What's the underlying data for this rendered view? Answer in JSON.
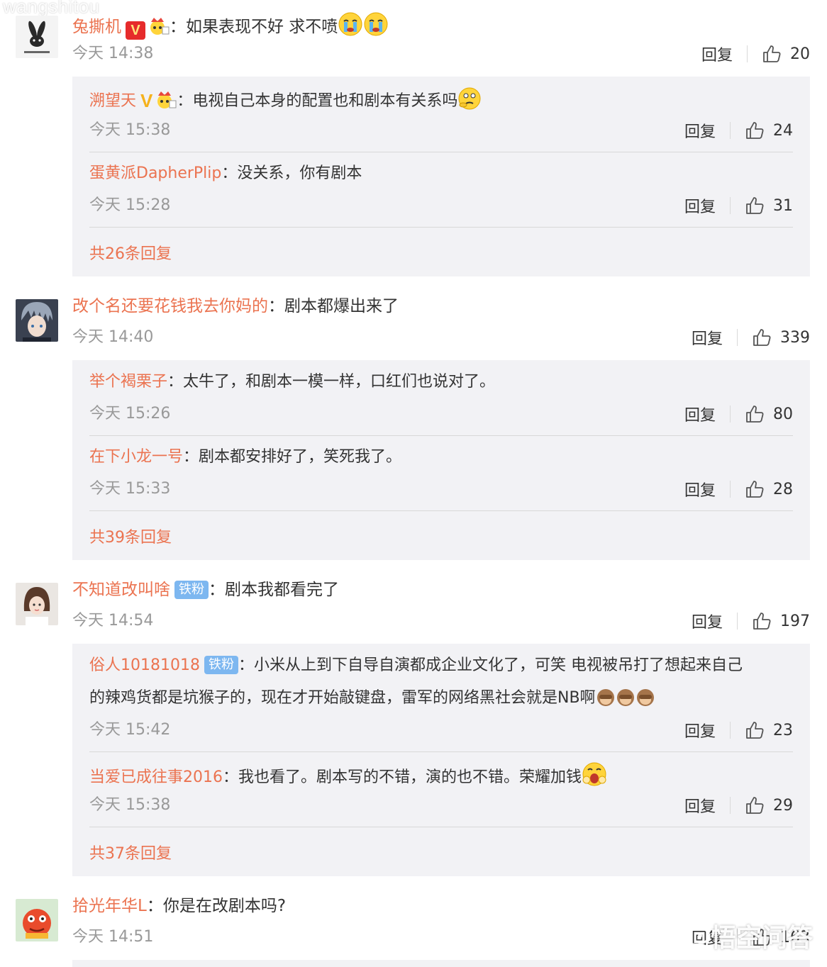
{
  "watermark_top": "wangshitou",
  "brand_watermark": "悟空问答",
  "colors": {
    "username": "#eb7350",
    "reply_bg": "#f2f2f5"
  },
  "comments": [
    {
      "username": "兔撕机",
      "text": "如果表现不好 求不喷",
      "time": "今天 14:38",
      "reply_label": "回复",
      "likes": "20",
      "replies": [
        {
          "username": "溯望天",
          "text": "电视自己本身的配置也和剧本有关系吗",
          "time": "今天 15:38",
          "reply_label": "回复",
          "likes": "24"
        },
        {
          "username": "蛋黄派DapherPlip",
          "text": "没关系，你有剧本",
          "time": "今天 15:28",
          "reply_label": "回复",
          "likes": "31"
        }
      ],
      "more": "共26条回复"
    },
    {
      "username": "改个名还要花钱我去你妈的",
      "text": "剧本都爆出来了",
      "time": "今天 14:40",
      "reply_label": "回复",
      "likes": "339",
      "replies": [
        {
          "username": "举个褐栗子",
          "text": "太牛了，和剧本一模一样，口红们也说对了。",
          "time": "今天 15:26",
          "reply_label": "回复",
          "likes": "80"
        },
        {
          "username": "在下小龙一号",
          "text": "剧本都安排好了，笑死我了。",
          "time": "今天 15:33",
          "reply_label": "回复",
          "likes": "28"
        }
      ],
      "more": "共39条回复"
    },
    {
      "username": "不知道改叫啥",
      "badge": "铁粉",
      "text": "剧本我都看完了",
      "time": "今天 14:54",
      "reply_label": "回复",
      "likes": "197",
      "replies": [
        {
          "username": "俗人10181018",
          "badge": "铁粉",
          "text": "小米从上到下自导自演都成企业文化了，可笑 电视被吊打了想起来自己",
          "text2": "的辣鸡货都是坑猴子的，现在才开始敲键盘，雷军的网络黑社会就是NB啊",
          "time": "今天 15:42",
          "reply_label": "回复",
          "likes": "23"
        },
        {
          "username": "当爱已成往事2016",
          "text": "我也看了。剧本写的不错，演的也不错。荣耀加钱",
          "time": "今天 15:38",
          "reply_label": "回复",
          "likes": "29"
        }
      ],
      "more": "共37条回复"
    },
    {
      "username": "拾光年华L",
      "text": "你是在改剧本吗?",
      "time": "今天 14:51",
      "reply_label": "回复",
      "likes": "163"
    }
  ],
  "colon": "："
}
